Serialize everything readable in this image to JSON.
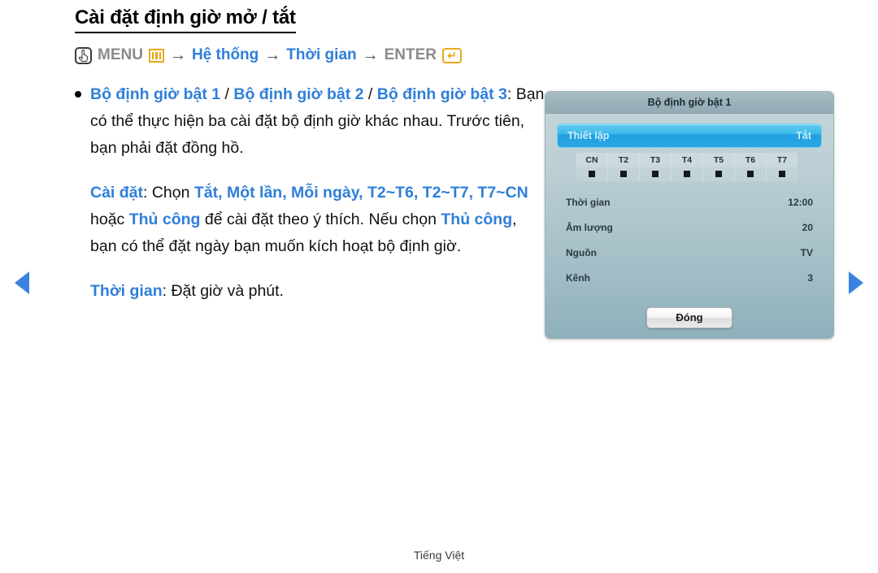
{
  "page": {
    "title": "Cài đặt định giờ mở / tắt",
    "footer": "Tiếng Việt"
  },
  "breadcrumb": {
    "remote_icon": "remote-hand-icon",
    "menu_label": "MENU",
    "menu_icon": "menu-bars-icon",
    "arrow1": "→",
    "step1": "Hệ thống",
    "arrow2": "→",
    "step2": "Thời gian",
    "arrow3": "→",
    "enter_label": "ENTER",
    "enter_icon": "enter-return-icon"
  },
  "body": {
    "para1": {
      "t1": "Bộ định giờ bật 1",
      "sep1": " / ",
      "t2": "Bộ định giờ bật 2",
      "sep2": " /",
      "t3": "Bộ định giờ bật 3",
      "rest": ": Bạn có thể thực hiện ba cài đặt bộ định giờ khác nhau. Trước tiên, bạn phải đặt đồng hồ."
    },
    "para2": {
      "label": "Cài đặt",
      "lead": ": Chọn ",
      "opt1": "Tắt, Một lần, Mỗi ngày, T2~T6, T2~T7, T7~CN",
      "mid": " hoặc ",
      "opt2": "Thủ công",
      "mid2": " để cài đặt theo ý thích. Nếu chọn ",
      "opt3": "Thủ công",
      "tail": ", bạn có thể đặt ngày bạn muốn kích hoạt bộ định giờ."
    },
    "para3": {
      "label": "Thời gian",
      "rest": ": Đặt giờ và phút."
    }
  },
  "dialog": {
    "title": "Bộ định giờ bật 1",
    "highlight": {
      "label": "Thiết lập",
      "value": "Tắt"
    },
    "days": [
      "CN",
      "T2",
      "T3",
      "T4",
      "T5",
      "T6",
      "T7"
    ],
    "rows": [
      {
        "label": "Thời gian",
        "value": "12:00"
      },
      {
        "label": "Âm lượng",
        "value": "20"
      },
      {
        "label": "Nguồn",
        "value": "TV"
      },
      {
        "label": "Kênh",
        "value": "3"
      }
    ],
    "close_label": "Đóng"
  },
  "nav": {
    "prev_icon": "triangle-left-icon",
    "next_icon": "triangle-right-icon"
  },
  "colors": {
    "accent_blue": "#2f7fd8",
    "orange": "#e8a91d",
    "highlight_blue": "#2aa7e4",
    "dialog_bg_top": "#c4d5d9",
    "dialog_bg_bottom": "#8fb0bb"
  }
}
